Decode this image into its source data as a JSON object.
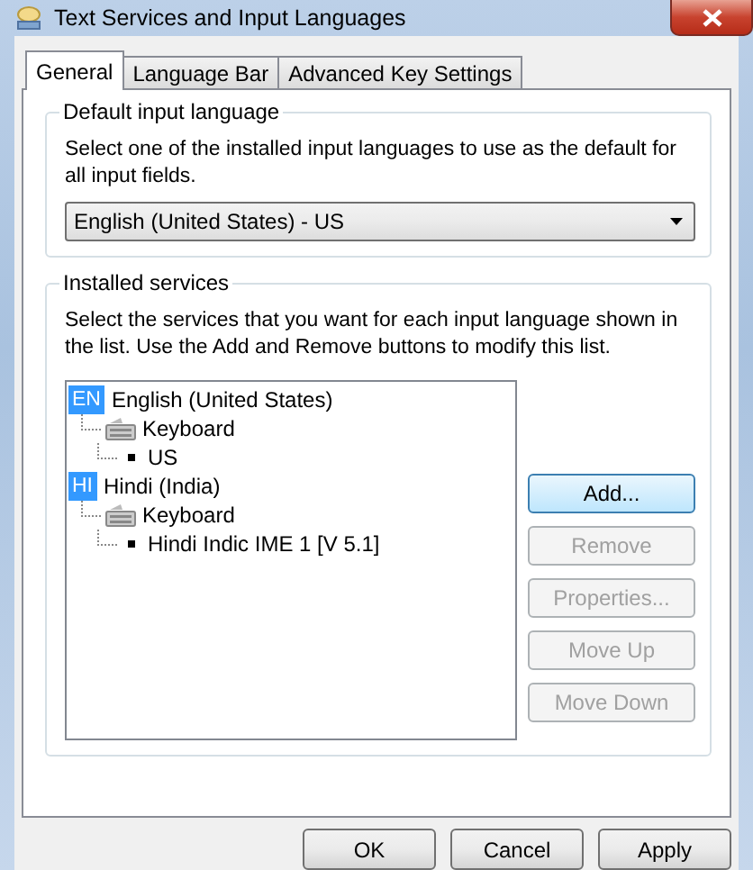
{
  "window": {
    "title": "Text Services and Input Languages"
  },
  "tabs": [
    {
      "label": "General",
      "selected": true
    },
    {
      "label": "Language Bar",
      "selected": false
    },
    {
      "label": "Advanced Key Settings",
      "selected": false
    }
  ],
  "default_input_language": {
    "legend": "Default input language",
    "description": "Select one of the installed input languages to use as the default for all input fields.",
    "dropdown": {
      "value": "English (United States) - US"
    }
  },
  "installed_services": {
    "legend": "Installed services",
    "description": "Select the services that you want for each input language shown in the list. Use the Add and Remove buttons to modify this list.",
    "tree": [
      {
        "kind": "language",
        "badge": "EN",
        "label": "English (United States)",
        "children": [
          {
            "kind": "category",
            "label": "Keyboard",
            "children": [
              {
                "kind": "service",
                "label": "US"
              }
            ]
          }
        ]
      },
      {
        "kind": "language",
        "badge": "HI",
        "label": "Hindi (India)",
        "children": [
          {
            "kind": "category",
            "label": "Keyboard",
            "children": [
              {
                "kind": "service",
                "label": "Hindi Indic IME 1 [V 5.1]"
              }
            ]
          }
        ]
      }
    ],
    "buttons": [
      {
        "label": "Add...",
        "disabled": false,
        "focused": true
      },
      {
        "label": "Remove",
        "disabled": true,
        "focused": false
      },
      {
        "label": "Properties...",
        "disabled": true,
        "focused": false
      },
      {
        "label": "Move Up",
        "disabled": true,
        "focused": false
      },
      {
        "label": "Move Down",
        "disabled": true,
        "focused": false
      }
    ]
  },
  "dialog_buttons": [
    {
      "label": "OK"
    },
    {
      "label": "Cancel"
    },
    {
      "label": "Apply"
    }
  ]
}
